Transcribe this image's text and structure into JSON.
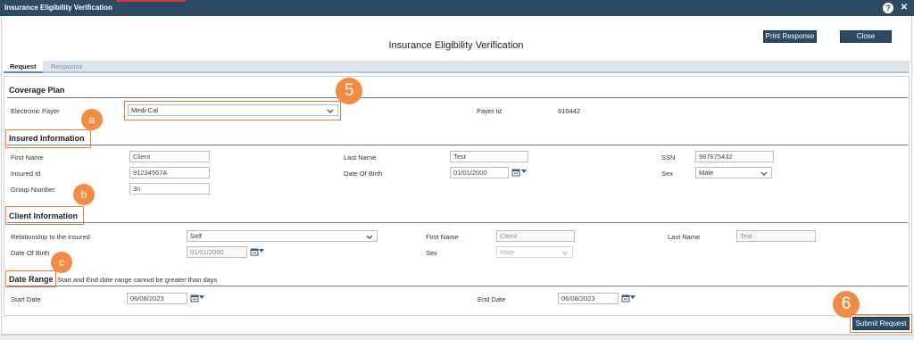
{
  "window": {
    "title": "Insurance Eligibility Verification"
  },
  "header": {
    "title": "Insurance Eligibility Verification",
    "print_button": "Print Response",
    "close_button": "Close"
  },
  "tabs": [
    {
      "label": "Request",
      "active": true
    },
    {
      "label": "Response",
      "active": false
    }
  ],
  "coverage_plan": {
    "title": "Coverage Plan",
    "electronic_payer_label": "Electronic Payer",
    "electronic_payer_value": "Medi-Cal",
    "payer_id_label": "Payer Id",
    "payer_id_value": "610442"
  },
  "insured_information": {
    "title": "Insured Information",
    "first_name_label": "First Name",
    "first_name_value": "Client",
    "last_name_label": "Last Name",
    "last_name_value": "Test",
    "ssn_label": "SSN",
    "ssn_value": "987675432",
    "insured_id_label": "Insured Id",
    "insured_id_value": "91234567A",
    "dob_label": "Date Of Birth",
    "dob_value": "01/01/2000",
    "sex_label": "Sex",
    "sex_value": "Male",
    "group_number_label": "Group Number",
    "group_number_value": "3n"
  },
  "client_information": {
    "title": "Client Information",
    "relationship_label": "Relationship to the insured",
    "relationship_value": "Self",
    "first_name_label": "First Name",
    "first_name_value": "Client",
    "last_name_label": "Last Name",
    "last_name_value": "Test",
    "dob_label": "Date Of Birth",
    "dob_value": "01/01/2000",
    "sex_label": "Sex",
    "sex_value": "Male"
  },
  "date_range": {
    "title": "Date Range",
    "note": "Start and End date range cannot be greater than days",
    "start_label": "Start Date",
    "start_value": "06/08/2023",
    "end_label": "End Date",
    "end_value": "06/08/2023"
  },
  "submit_button": "Submit Request",
  "annotations": {
    "a": "a",
    "b": "b",
    "c": "c",
    "five": "5",
    "six": "6"
  },
  "colors": {
    "header": "#2c4a63",
    "annotation": "#f28b44"
  }
}
